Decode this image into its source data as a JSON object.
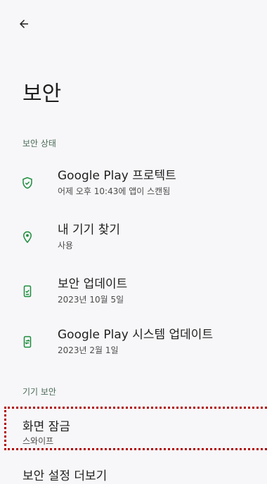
{
  "header": {
    "back_icon": "arrow-back-icon"
  },
  "page": {
    "title": "보안"
  },
  "sections": {
    "security_status": {
      "label": "보안 상태"
    },
    "device_security": {
      "label": "기기 보안"
    }
  },
  "items": {
    "play_protect": {
      "title": "Google Play 프로텍트",
      "subtitle": "어제 오후 10:43에 앱이 스캔됨",
      "icon": "shield-check-icon"
    },
    "find_device": {
      "title": "내 기기 찾기",
      "subtitle": "사용",
      "icon": "location-pin-icon"
    },
    "security_update": {
      "title": "보안 업데이트",
      "subtitle": "2023년 10월 5일",
      "icon": "phone-check-icon"
    },
    "play_system_update": {
      "title": "Google Play 시스템 업데이트",
      "subtitle": "2023년 2월 1일",
      "icon": "phone-sync-icon"
    },
    "screen_lock": {
      "title": "화면 잠금",
      "subtitle": "스와이프"
    },
    "more_settings": {
      "title": "보안 설정 더보기"
    }
  },
  "colors": {
    "accent_green": "#1e8e3e",
    "background": "#f7f7f9",
    "highlight": "#b20000"
  }
}
